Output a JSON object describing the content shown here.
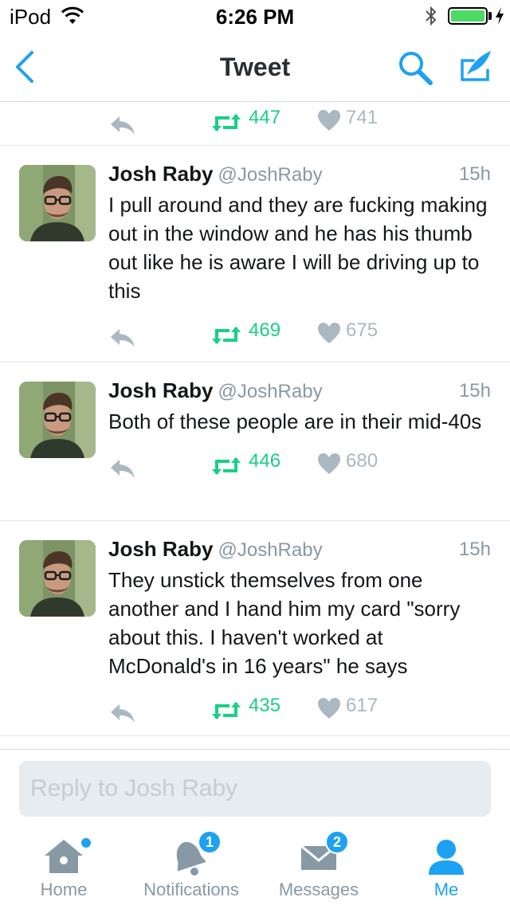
{
  "status_bar": {
    "carrier": "iPod",
    "time": "6:26 PM"
  },
  "nav": {
    "title": "Tweet"
  },
  "partial_tweet": {
    "retweets": "447",
    "likes": "741"
  },
  "tweets": [
    {
      "name": "Josh Raby",
      "handle": "@JoshRaby",
      "time": "15h",
      "text": "I pull around and they are fucking making out in the window and he has his thumb out like he is aware I will be driving up to this",
      "retweets": "469",
      "likes": "675"
    },
    {
      "name": "Josh Raby",
      "handle": "@JoshRaby",
      "time": "15h",
      "text": "Both of these people are in their mid-40s",
      "retweets": "446",
      "likes": "680"
    },
    {
      "name": "Josh Raby",
      "handle": "@JoshRaby",
      "time": "15h",
      "text": "They unstick themselves from one another and I hand him my card \"sorry about this. I haven't worked at McDonald's in 16 years\" he says",
      "retweets": "435",
      "likes": "617"
    }
  ],
  "reply": {
    "placeholder": "Reply to Josh Raby"
  },
  "tabs": {
    "home": {
      "label": "Home"
    },
    "notifications": {
      "label": "Notifications",
      "badge": "1"
    },
    "messages": {
      "label": "Messages",
      "badge": "2"
    },
    "me": {
      "label": "Me"
    }
  },
  "colors": {
    "accent": "#1da1f2",
    "retweet": "#19cf86",
    "muted": "#aab8c2",
    "battery": "#4cd964"
  }
}
